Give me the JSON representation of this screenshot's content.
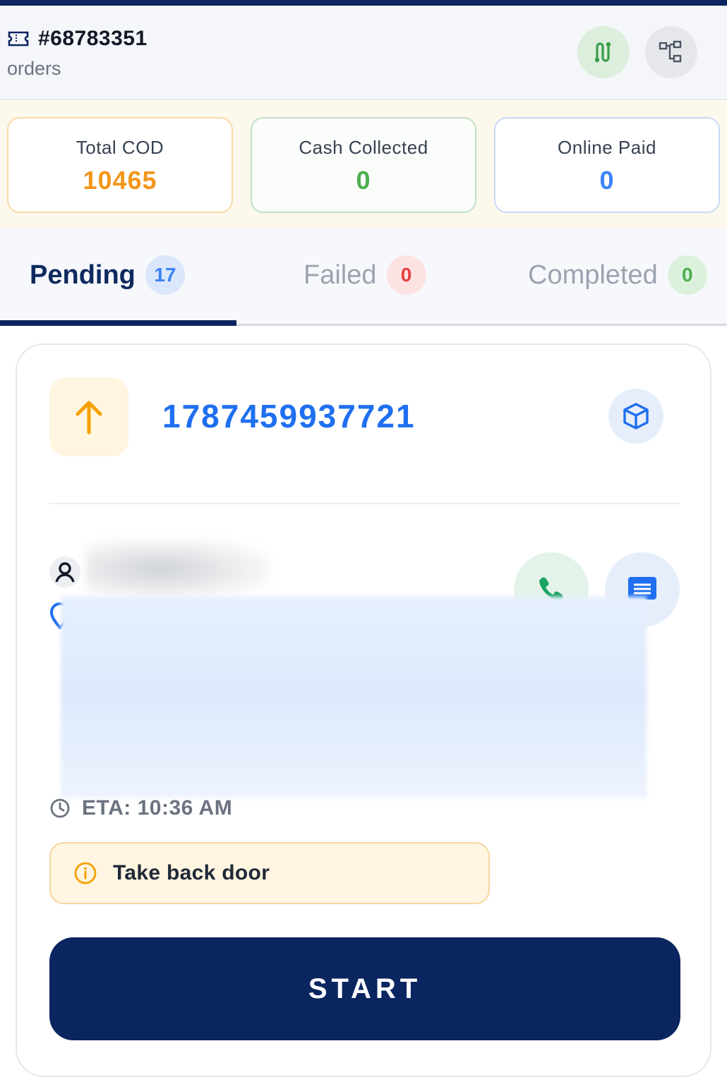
{
  "header": {
    "route_id": "#68783351",
    "subtitle": "orders",
    "icons": [
      "ticket-icon",
      "route-icon",
      "hierarchy-icon"
    ]
  },
  "cod": {
    "total_label": "Total COD",
    "total_value": "10465",
    "cash_label": "Cash Collected",
    "cash_value": "0",
    "online_label": "Online Paid",
    "online_value": "0"
  },
  "tabs": [
    {
      "label": "Pending",
      "count": "17",
      "active": true
    },
    {
      "label": "Failed",
      "count": "0",
      "active": false
    },
    {
      "label": "Completed",
      "count": "0",
      "active": false
    }
  ],
  "order": {
    "number": "1787459937721",
    "direction_icon": "arrow-up-icon",
    "eta": "ETA: 10:36 AM",
    "note": "Take back door",
    "start_label": "START"
  },
  "colors": {
    "brand_navy": "#0b2560",
    "accent_blue": "#1f6ff0",
    "cod_orange": "#f2961b",
    "cash_green": "#4caf50",
    "failed_red": "#e53e3e"
  }
}
